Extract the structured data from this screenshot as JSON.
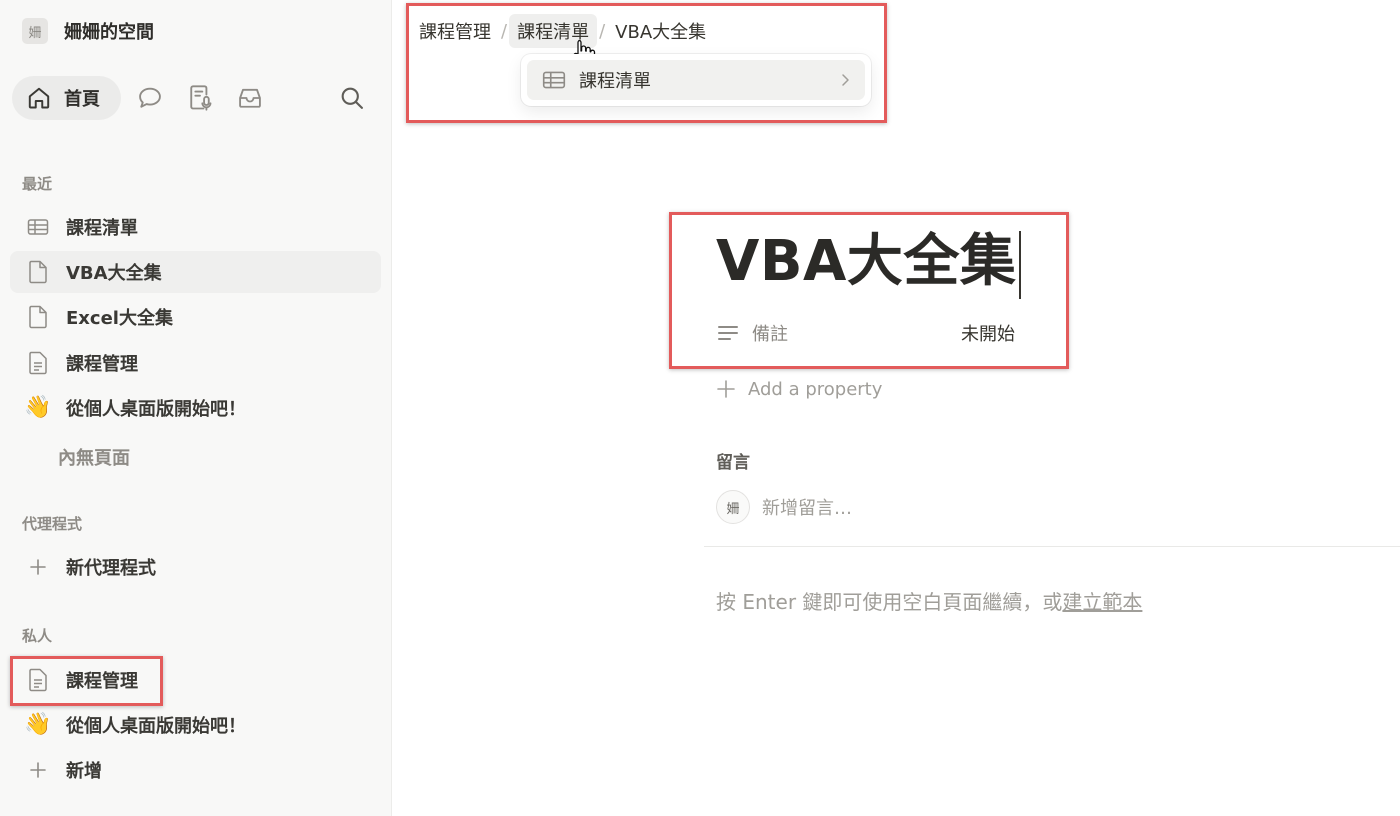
{
  "workspace": {
    "avatar": "姍",
    "name": "姍姍的空間"
  },
  "topnav": {
    "home_label": "首頁",
    "icons": [
      "home-icon",
      "chat-icon",
      "meeting-notes-icon",
      "inbox-icon",
      "search-icon"
    ]
  },
  "sidebar": {
    "recent_label": "最近",
    "recent": [
      {
        "icon": "table-icon",
        "label": "課程清單"
      },
      {
        "icon": "page-icon",
        "label": "VBA大全集",
        "active": true
      },
      {
        "icon": "page-icon",
        "label": "Excel大全集"
      },
      {
        "icon": "doc-icon",
        "label": "課程管理"
      },
      {
        "icon": "wave-emoji",
        "emoji": "👋",
        "label": "從個人桌面版開始吧！"
      }
    ],
    "empty_pages": "內無頁面",
    "agents_label": "代理程式",
    "new_agent": "新代理程式",
    "private_label": "私人",
    "private": [
      {
        "icon": "doc-icon",
        "label": "課程管理"
      },
      {
        "icon": "wave-emoji",
        "emoji": "👋",
        "label": "從個人桌面版開始吧！"
      }
    ],
    "add_new": "新增"
  },
  "breadcrumb": [
    "課程管理",
    "課程清單",
    "VBA大全集"
  ],
  "popup": {
    "item_label": "課程清單"
  },
  "page": {
    "title": "VBA大全集",
    "property_name": "備註",
    "property_value": "未開始",
    "add_property": "Add a property",
    "comments_heading": "留言",
    "comment_avatar": "姍",
    "comment_placeholder": "新增留言…",
    "hint_prefix": "按 Enter 鍵即可使用空白頁面繼續，或",
    "hint_link": "建立範本"
  },
  "colors": {
    "highlight_border": "#e35b5b",
    "sidebar_bg": "#f8f8f7",
    "text": "#37352f"
  }
}
